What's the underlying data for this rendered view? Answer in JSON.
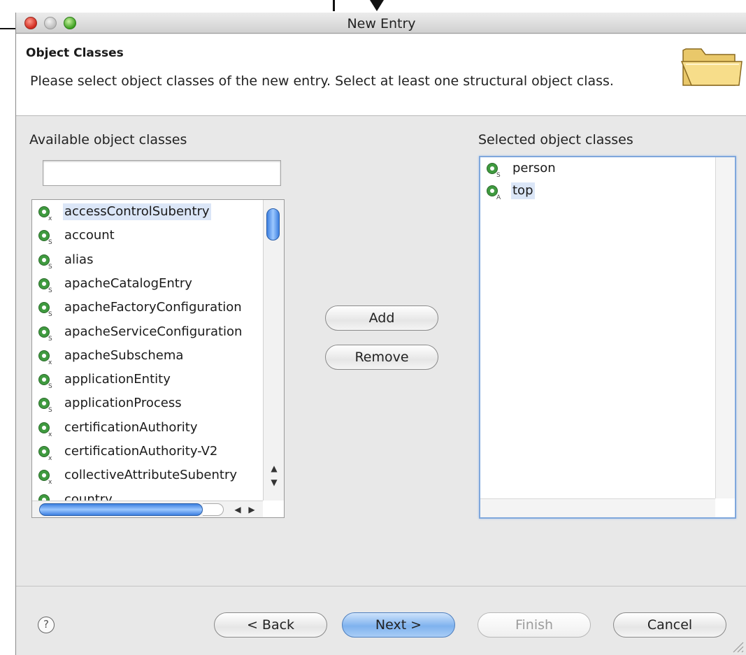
{
  "window": {
    "title": "New Entry"
  },
  "header": {
    "title": "Object Classes",
    "description": "Please select object classes of the new entry. Select at least one structural object class.",
    "icon": "folder-icon"
  },
  "available": {
    "label": "Available object classes",
    "filter_value": "",
    "items": [
      {
        "label": "accessControlSubentry",
        "kind": "X",
        "highlighted": true
      },
      {
        "label": "account",
        "kind": "S"
      },
      {
        "label": "alias",
        "kind": "S"
      },
      {
        "label": "apacheCatalogEntry",
        "kind": "S"
      },
      {
        "label": "apacheFactoryConfiguration",
        "kind": "S"
      },
      {
        "label": "apacheServiceConfiguration",
        "kind": "S"
      },
      {
        "label": "apacheSubschema",
        "kind": "X"
      },
      {
        "label": "applicationEntity",
        "kind": "S"
      },
      {
        "label": "applicationProcess",
        "kind": "S"
      },
      {
        "label": "certificationAuthority",
        "kind": "X"
      },
      {
        "label": "certificationAuthority-V2",
        "kind": "X"
      },
      {
        "label": "collectiveAttributeSubentry",
        "kind": "X"
      },
      {
        "label": "country",
        "kind": "S"
      }
    ]
  },
  "actions": {
    "add_label": "Add",
    "remove_label": "Remove"
  },
  "selected": {
    "label": "Selected object classes",
    "items": [
      {
        "label": "person",
        "kind": "S"
      },
      {
        "label": "top",
        "kind": "A",
        "highlighted": true
      }
    ]
  },
  "footer": {
    "help_glyph": "?",
    "back_label": "< Back",
    "next_label": "Next >",
    "finish_label": "Finish",
    "cancel_label": "Cancel"
  },
  "colors": {
    "icon_green": "#3f9a3f",
    "selection": "#dbe6f7",
    "focus_ring": "#7fa7dc"
  }
}
